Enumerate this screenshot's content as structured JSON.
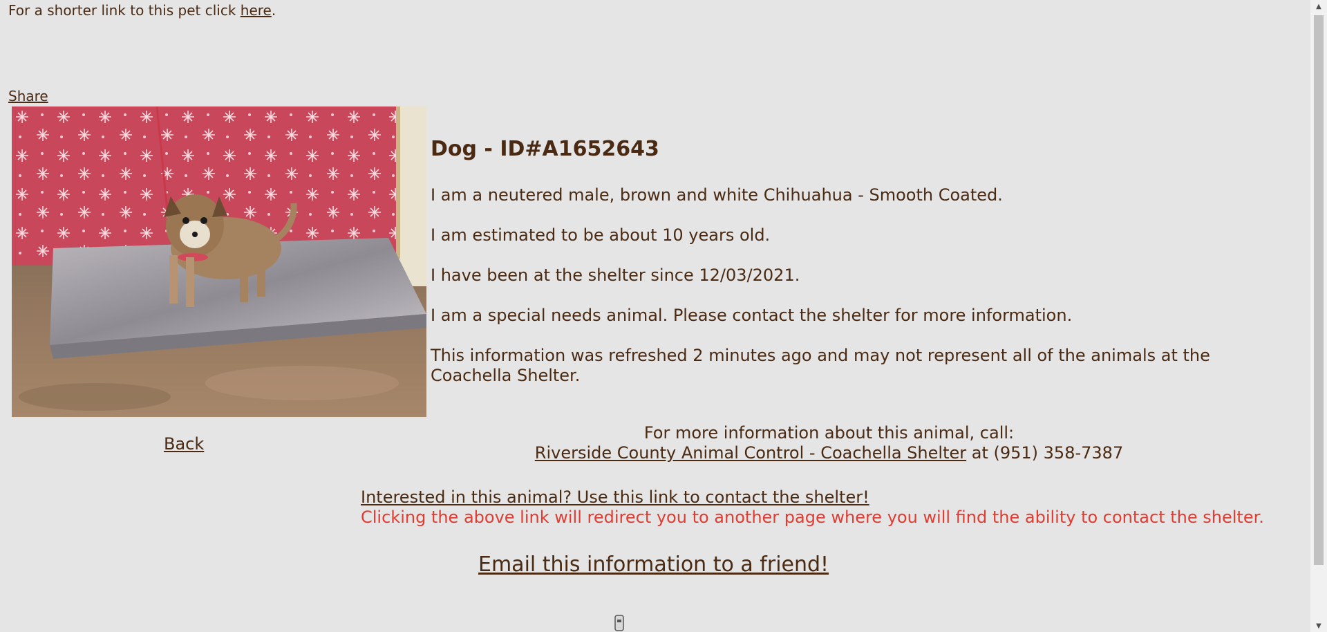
{
  "top": {
    "short_link_prefix": "For a shorter link to this pet click ",
    "short_link_label": "here",
    "short_link_suffix": "."
  },
  "share_label": "Share",
  "back_label": "Back",
  "animal": {
    "title": "Dog - ID#A1652643",
    "description": "I am a neutered male, brown and white Chihuahua - Smooth Coated.",
    "age": "I am estimated to be about 10 years old.",
    "since": "I have been at the shelter since 12/03/2021.",
    "special_needs": "I am a special needs animal. Please contact the shelter for more information.",
    "refresh_note": "This information was refreshed 2 minutes ago and may not represent all of the animals at the Coachella Shelter."
  },
  "contact": {
    "heading": "For more information about this animal, call:",
    "shelter_link": "Riverside County Animal Control - Coachella Shelter",
    "phone_text": " at (951) 358-7387",
    "interested_link": "Interested in this animal? Use this link to contact the shelter!",
    "redirect_note": "Clicking the above link will redirect you to another page where you will find the ability to contact the shelter.",
    "email_link": "Email this information to a friend!"
  },
  "colors": {
    "background": "#e5e5e5",
    "text": "#4a2a12",
    "warning": "#e03c31"
  }
}
